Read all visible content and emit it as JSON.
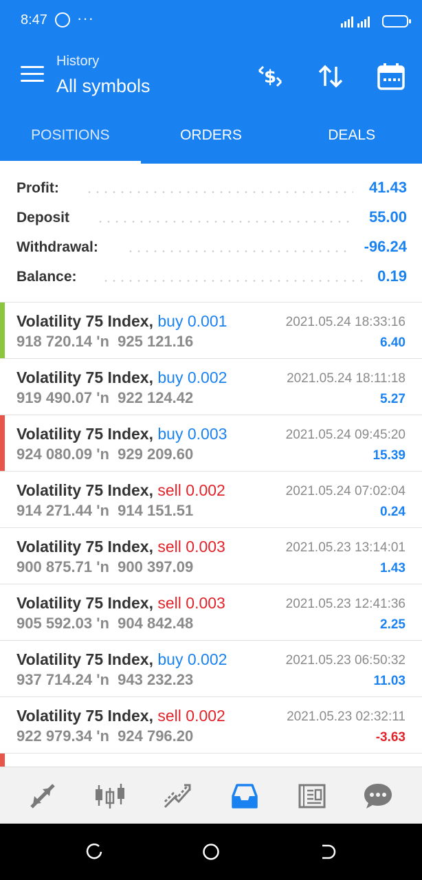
{
  "status_bar": {
    "time": "8:47",
    "more": "···"
  },
  "header": {
    "subtitle": "History",
    "title": "All symbols"
  },
  "tabs": [
    {
      "label": "POSITIONS",
      "active": true
    },
    {
      "label": "ORDERS",
      "active": false
    },
    {
      "label": "DEALS",
      "active": false
    }
  ],
  "summary": [
    {
      "label": "Profit:",
      "value": "41.43"
    },
    {
      "label": "Deposit",
      "value": "55.00"
    },
    {
      "label": "Withdrawal:",
      "value": "-96.24"
    },
    {
      "label": "Balance:",
      "value": "0.19"
    }
  ],
  "positions": [
    {
      "symbol": "Volatility 75 Index,",
      "side": "buy",
      "volume": "buy 0.001",
      "open": "918 720.14",
      "close": "925 121.16",
      "arrow": "'n",
      "date": "2021.05.24 18:33:16",
      "profit": "6.40",
      "marker": "#8cc63f"
    },
    {
      "symbol": "Volatility 75 Index,",
      "side": "buy",
      "volume": "buy 0.002",
      "open": "919 490.07",
      "close": "922 124.42",
      "arrow": "'n",
      "date": "2021.05.24 18:11:18",
      "profit": "5.27",
      "marker": ""
    },
    {
      "symbol": "Volatility 75 Index,",
      "side": "buy",
      "volume": "buy 0.003",
      "open": "924 080.09",
      "close": "929 209.60",
      "arrow": "'n",
      "date": "2021.05.24 09:45:20",
      "profit": "15.39",
      "marker": "#e8554b"
    },
    {
      "symbol": "Volatility 75 Index,",
      "side": "sell",
      "volume": "sell 0.002",
      "open": "914 271.44",
      "close": "914 151.51",
      "arrow": "'n",
      "date": "2021.05.24 07:02:04",
      "profit": "0.24",
      "marker": ""
    },
    {
      "symbol": "Volatility 75 Index,",
      "side": "sell",
      "volume": "sell 0.003",
      "open": "900 875.71",
      "close": "900 397.09",
      "arrow": "'n",
      "date": "2021.05.23 13:14:01",
      "profit": "1.43",
      "marker": ""
    },
    {
      "symbol": "Volatility 75 Index,",
      "side": "sell",
      "volume": "sell 0.003",
      "open": "905 592.03",
      "close": "904 842.48",
      "arrow": "'n",
      "date": "2021.05.23 12:41:36",
      "profit": "2.25",
      "marker": ""
    },
    {
      "symbol": "Volatility 75 Index,",
      "side": "buy",
      "volume": "buy 0.002",
      "open": "937 714.24",
      "close": "943 232.23",
      "arrow": "'n",
      "date": "2021.05.23 06:50:32",
      "profit": "11.03",
      "marker": ""
    },
    {
      "symbol": "Volatility 75 Index,",
      "side": "sell",
      "volume": "sell 0.002",
      "open": "922 979.34",
      "close": "924 796.20",
      "arrow": "'n",
      "date": "2021.05.23 02:32:11",
      "profit": "-3.63",
      "marker": ""
    }
  ],
  "bottom_nav": [
    {
      "name": "quotes-icon"
    },
    {
      "name": "chart-icon"
    },
    {
      "name": "trade-icon"
    },
    {
      "name": "history-icon",
      "active": true
    },
    {
      "name": "news-icon"
    },
    {
      "name": "messages-icon"
    }
  ],
  "colors": {
    "accent": "#1a82f0",
    "buy": "#1a82f0",
    "sell": "#e0242a",
    "inactive_icon": "#7a7a7a"
  }
}
